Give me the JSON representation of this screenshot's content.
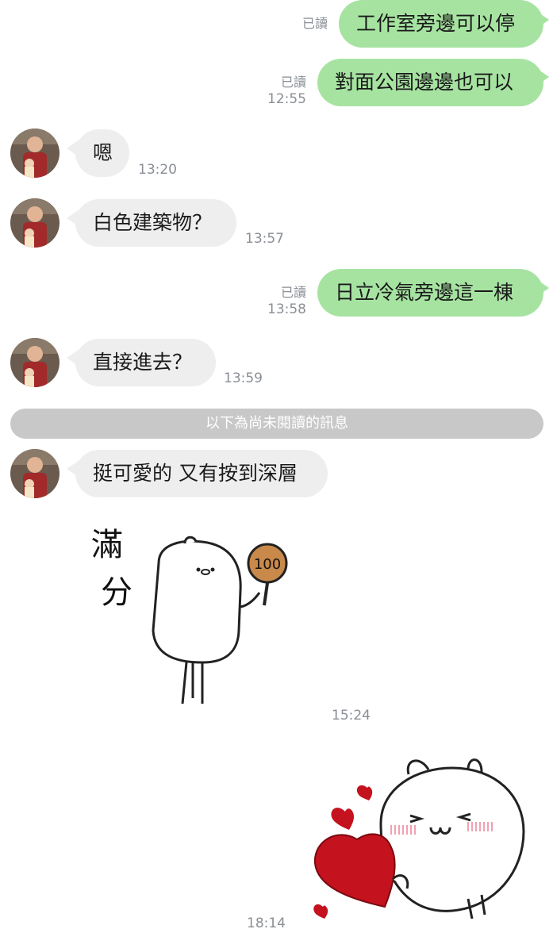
{
  "messages": [
    {
      "text": "工作室旁邊可以停",
      "read": "已讀"
    },
    {
      "text": "對面公園邊邊也可以",
      "read": "已讀",
      "time": "12:55"
    },
    {
      "text": "嗯",
      "time": "13:20"
    },
    {
      "text": "白色建築物？",
      "time": "13:57"
    },
    {
      "text": "日立冷氣旁邊這一棟",
      "read": "已讀",
      "time": "13:58"
    },
    {
      "text": "直接進去？",
      "time": "13:59"
    },
    {
      "text": "挺可愛的 又有按到深層"
    }
  ],
  "unread_divider": "以下為尚未閱讀的訊息",
  "stickers": [
    {
      "text_line1": "滿",
      "text_line2": "分",
      "sign": "100",
      "time": "15:24"
    },
    {
      "time": "18:14"
    }
  ],
  "colors": {
    "outgoing": "#a6e3a1",
    "incoming": "#eeeeef",
    "divider": "#c8c8c8",
    "heart": "#c4121e"
  }
}
